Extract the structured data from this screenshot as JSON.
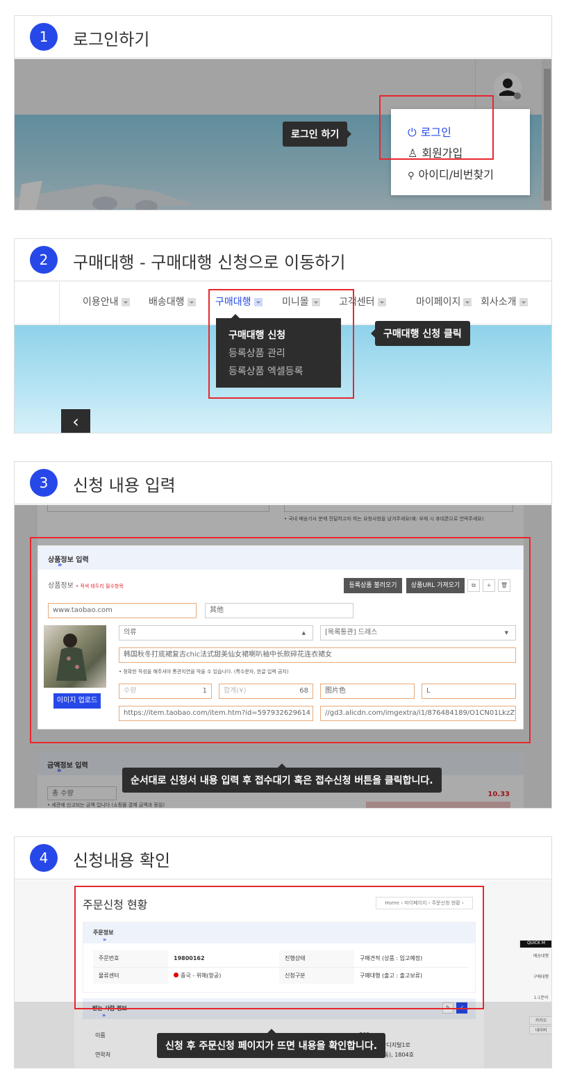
{
  "steps": [
    {
      "num": "1",
      "title": "로그인하기"
    },
    {
      "num": "2",
      "title": "구매대행 - 구매대행 신청으로 이동하기"
    },
    {
      "num": "3",
      "title": "신청 내용 입력"
    },
    {
      "num": "4",
      "title": "신청내용 확인"
    }
  ],
  "step1": {
    "tooltip": "로그인 하기",
    "menu": [
      {
        "icon": "power-icon",
        "label": "로그인"
      },
      {
        "icon": "person-add-icon",
        "label": "회원가입"
      },
      {
        "icon": "search-icon",
        "label": "아이디/비번찾기"
      }
    ]
  },
  "step2": {
    "nav": [
      "이용안내",
      "배송대행",
      "구매대행",
      "미니몰",
      "고객센터",
      "마이페이지",
      "회사소개"
    ],
    "dropdown": [
      "구매대행 신청",
      "등록상품 관리",
      "등록상품 엑셀등록"
    ],
    "tooltip": "구매대행 신청 클릭",
    "back_glyph": "‹"
  },
  "step3": {
    "top_note": "• 국내 배송기사 분께 전달하고자 하는 요청사항을 남겨주세요(예: 부재 시 휴대폰으로 연락주세요)",
    "section_title": "상품정보 입력",
    "arrows": "»",
    "info_label": "상품정보",
    "required_note": "• 적색 테두리 필수항목",
    "btn_load": "등록상품 불러오기",
    "btn_url": "상품URL 가져오기",
    "site": "www.taobao.com",
    "shop": "其他",
    "category": "의류",
    "category2": "[목록통관] 드레스",
    "product_name": "韩国秋冬打底裙复古chic法式甜美仙女裙喇叭袖中长款碎花连衣裙女",
    "name_note": "• 정확한 작성을 해주셔야 통관지연을 막을 수 있습니다. (특수문자, 한글 입력 금지)",
    "qty_label": "수량",
    "qty": "1",
    "total_label": "합계(¥)",
    "total": "68",
    "color": "图片色",
    "size": "L",
    "url": "https://item.taobao.com/item.htm?id=597932629614",
    "img_url": "//gd3.alicdn.com/imgextra/i1/876484189/O1CN01LkzZt51gc",
    "upload_btn": "이미지 업로드",
    "price_section": "금액정보 입력",
    "total_qty_label": "총 수량",
    "total_value": "10.33",
    "price_note": "• 세관에 신고되는 금액 입니다 (쇼핑몰 결제 금액과 동일)",
    "tooltip": "순서대로 신청서 내용 입력 후 접수대기 혹은 접수신청 버튼을 클릭합니다."
  },
  "step4": {
    "page_title": "주문신청 현황",
    "breadcrumb": "Home › 마이페이지 › 주문신청 현황 ›",
    "section_title": "주문정보",
    "rows": [
      {
        "k1": "주문번호",
        "v1": "19800162",
        "k2": "진행상태",
        "v2": "구매견적 (상품 : 입고예정)"
      },
      {
        "k1": "물류센터",
        "v1": "중국 - 위해(항공)",
        "k2": "신청구분",
        "v2": "구매대행 (출고 : 출고보류)"
      }
    ],
    "receiver_title": "받는 사람 정보",
    "recv_rows": [
      "이름",
      "연락처"
    ],
    "addr1": "802",
    "addr2": "금천구 가산디지털1로",
    "addr3": "181 (가산동), 1804호",
    "quick": [
      "QUICK M",
      "배송대행",
      "구매대행",
      "1:1문의",
      "카카오",
      "네이버"
    ],
    "tooltip": "신청 후 주문신청 페이지가 뜨면 내용을 확인합니다."
  }
}
